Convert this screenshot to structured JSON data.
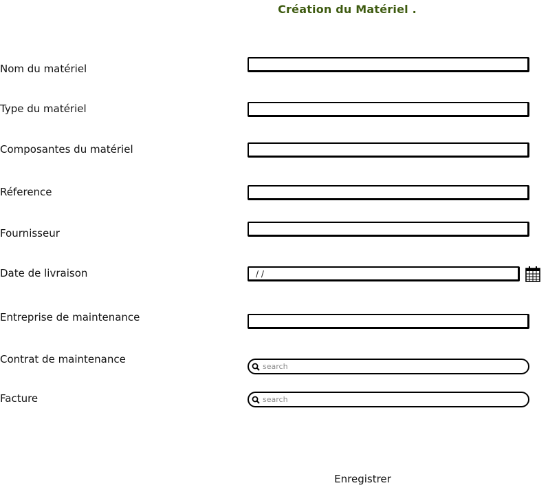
{
  "title": "Création du Matériel .",
  "fields": {
    "nom_label": "Nom du matériel",
    "nom_value": "",
    "type_label": "Type du matériel",
    "type_value": "",
    "composantes_label": "Composantes du matériel",
    "composantes_value": "",
    "reference_label": "Réference",
    "reference_value": "",
    "fournisseur_label": "Fournisseur",
    "fournisseur_value": "",
    "date_label": "Date de livraison",
    "date_value": "/ /",
    "entreprise_label": "Entreprise de maintenance",
    "entreprise_value": "",
    "contrat_label": "Contrat de maintenance",
    "contrat_placeholder": "search",
    "facture_label": "Facture",
    "facture_placeholder": "search"
  },
  "icons": {
    "date": "calendar-icon",
    "search": "search-icon"
  },
  "actions": {
    "save_label": "Enregistrer"
  },
  "colors": {
    "title": "#3d5a0f",
    "border": "#000000",
    "placeholder": "#8a8a8a"
  }
}
